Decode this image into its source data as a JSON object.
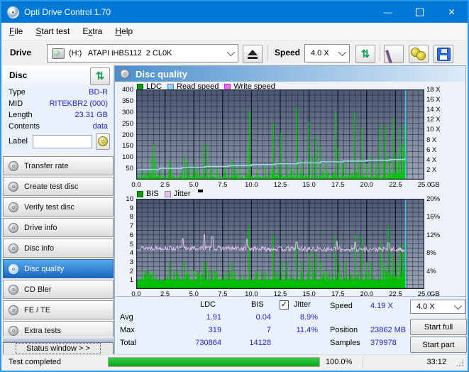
{
  "window": {
    "title": "Opti Drive Control 1.70"
  },
  "menu": {
    "items": [
      {
        "label": "File",
        "u": 0
      },
      {
        "label": "Start test",
        "u": 0
      },
      {
        "label": "Extra",
        "u": 1
      },
      {
        "label": "Help",
        "u": 0
      }
    ]
  },
  "toolbar": {
    "drive_label": "Drive",
    "drive_value": "(H:)   ATAPI iHBS112  2 CL0K",
    "speed_label": "Speed",
    "speed_value": "4.0 X",
    "icons": [
      "drive-icon",
      "eject-icon",
      "refresh-icon",
      "eraser-icon",
      "gold-discs-icon",
      "save-icon"
    ]
  },
  "sidebar": {
    "header": "Disc",
    "info": [
      {
        "label": "Type",
        "value": "BD-R"
      },
      {
        "label": "MID",
        "value": "RITEKBR2 (000)"
      },
      {
        "label": "Length",
        "value": "23.31 GB"
      },
      {
        "label": "Contents",
        "value": "data"
      }
    ],
    "label_field": {
      "label": "Label",
      "value": ""
    },
    "nav": [
      {
        "label": "Transfer rate",
        "active": false
      },
      {
        "label": "Create test disc",
        "active": false
      },
      {
        "label": "Verify test disc",
        "active": false
      },
      {
        "label": "Drive info",
        "active": false
      },
      {
        "label": "Disc info",
        "active": false
      },
      {
        "label": "Disc quality",
        "active": true
      },
      {
        "label": "CD Bler",
        "active": false
      },
      {
        "label": "FE / TE",
        "active": false
      },
      {
        "label": "Extra tests",
        "active": false
      }
    ],
    "status_window_button": "Status window > >"
  },
  "main": {
    "title": "Disc quality"
  },
  "colors": {
    "titlebar": "#0078d7",
    "accent_blue_value": "#2222dd",
    "ldc_green": "#00c800",
    "bis_green": "#00bf00",
    "read_speed_blue": "#9ad8f4",
    "write_speed_magenta": "#f06af0",
    "jitter_pink": "#e2c0ea",
    "end_marker_cyan": "#3cc6f2",
    "progress_green": "#13b31e"
  },
  "chart_data": [
    {
      "type": "bar",
      "name": "ldc-read-speed-chart",
      "legend": [
        {
          "label": "LDC",
          "color": "#0c9a0c"
        },
        {
          "label": "Read speed",
          "color": "#8fd2f2"
        },
        {
          "label": "Write speed",
          "color": "#f06af0"
        }
      ],
      "x_ticks": [
        0.0,
        2.5,
        5.0,
        7.5,
        10.0,
        12.5,
        15.0,
        17.5,
        20.0,
        22.5,
        25.0
      ],
      "x_unit": "GB",
      "x_max": 25.0,
      "y_left_ticks": [
        400,
        350,
        300,
        250,
        200,
        150,
        100,
        50
      ],
      "y_left_max": 400,
      "y_right_ticks": [
        "18 X",
        "16 X",
        "14 X",
        "12 X",
        "10 X",
        "8 X",
        "6 X",
        "4 X",
        "2 X"
      ],
      "y_right_max": 18,
      "data_end_gb": 23.38,
      "ldc_spikes": [
        [
          1.35,
          95
        ],
        [
          1.5,
          152
        ],
        [
          1.65,
          90
        ],
        [
          2.9,
          92
        ],
        [
          3.05,
          60
        ],
        [
          4.2,
          106
        ],
        [
          4.35,
          78
        ],
        [
          4.65,
          55
        ],
        [
          4.95,
          68
        ],
        [
          5.3,
          55
        ],
        [
          5.85,
          150
        ],
        [
          6.15,
          158
        ],
        [
          6.55,
          60
        ],
        [
          7.0,
          58
        ],
        [
          7.75,
          52
        ],
        [
          8.3,
          88
        ],
        [
          8.55,
          60
        ],
        [
          9.0,
          50
        ],
        [
          9.7,
          148
        ],
        [
          9.85,
          305
        ],
        [
          10.5,
          55
        ],
        [
          11.2,
          62
        ],
        [
          11.9,
          250
        ],
        [
          12.3,
          68
        ],
        [
          12.55,
          205
        ],
        [
          13.1,
          82
        ],
        [
          13.5,
          60
        ],
        [
          13.95,
          320
        ],
        [
          14.4,
          92
        ],
        [
          14.95,
          255
        ],
        [
          15.3,
          108
        ],
        [
          15.6,
          190
        ],
        [
          15.95,
          145
        ],
        [
          16.5,
          78
        ],
        [
          17.3,
          305
        ],
        [
          17.55,
          140
        ],
        [
          17.9,
          70
        ],
        [
          18.2,
          88
        ],
        [
          18.95,
          300
        ],
        [
          19.3,
          85
        ],
        [
          19.6,
          230
        ],
        [
          20.0,
          70
        ],
        [
          20.4,
          108
        ],
        [
          20.8,
          78
        ],
        [
          21.15,
          240
        ],
        [
          21.45,
          88
        ],
        [
          21.6,
          238
        ],
        [
          21.95,
          100
        ],
        [
          22.3,
          273
        ],
        [
          22.55,
          118
        ],
        [
          22.85,
          230
        ],
        [
          23.05,
          160
        ],
        [
          23.2,
          130
        ],
        [
          23.3,
          250
        ]
      ],
      "ldc_noise": {
        "seed": 7,
        "step_gb": 0.045,
        "base_min": 3,
        "base_var": 12,
        "spike_prob": 0.2,
        "spike_var": 28,
        "end_dense_from": 22.2
      },
      "read_speed_points": [
        [
          0,
          2.05
        ],
        [
          2,
          2.25
        ],
        [
          4,
          2.45
        ],
        [
          6,
          2.62
        ],
        [
          8,
          2.8
        ],
        [
          10,
          3.0
        ],
        [
          12,
          3.18
        ],
        [
          14,
          3.35
        ],
        [
          16,
          3.55
        ],
        [
          18,
          3.7
        ],
        [
          20,
          3.85
        ],
        [
          22,
          4.0
        ],
        [
          23.3,
          4.15
        ],
        [
          23.38,
          4.19
        ]
      ]
    },
    {
      "type": "bar",
      "name": "bis-jitter-chart",
      "legend": [
        {
          "label": "BIS",
          "color": "#0c9a0c"
        },
        {
          "label": "Jitter",
          "color": "#e2c0ea"
        }
      ],
      "x_ticks": [
        0.0,
        2.5,
        5.0,
        7.5,
        10.0,
        12.5,
        15.0,
        17.5,
        20.0,
        22.5,
        25.0
      ],
      "x_unit": "GB",
      "x_max": 25.0,
      "y_left_ticks": [
        10,
        9,
        8,
        7,
        6,
        5,
        4,
        3,
        2,
        1
      ],
      "y_left_max": 10,
      "y_right_ticks": [
        "20%",
        "16%",
        "12%",
        "8%",
        "4%"
      ],
      "y_right_max": 20,
      "data_end_gb": 23.38,
      "bis_base_level": 1,
      "bis_spikes": [
        [
          0.5,
          2
        ],
        [
          0.8,
          2
        ],
        [
          1.1,
          2
        ],
        [
          1.5,
          2
        ],
        [
          2.9,
          3
        ],
        [
          3.3,
          2
        ],
        [
          4.2,
          3
        ],
        [
          4.5,
          2
        ],
        [
          5.0,
          2
        ],
        [
          5.3,
          2
        ],
        [
          5.9,
          3
        ],
        [
          6.1,
          3
        ],
        [
          6.3,
          2
        ],
        [
          6.6,
          2
        ],
        [
          6.8,
          2
        ],
        [
          7.0,
          2
        ],
        [
          7.8,
          2
        ],
        [
          8.1,
          2
        ],
        [
          8.3,
          3
        ],
        [
          8.5,
          2
        ],
        [
          9.8,
          7
        ],
        [
          10.5,
          2
        ],
        [
          11.2,
          2
        ],
        [
          11.9,
          6
        ],
        [
          12.3,
          2
        ],
        [
          12.6,
          3
        ],
        [
          13.1,
          3
        ],
        [
          13.9,
          5
        ],
        [
          14.4,
          3
        ],
        [
          15.0,
          4
        ],
        [
          15.3,
          3
        ],
        [
          15.6,
          4
        ],
        [
          16.0,
          3
        ],
        [
          16.5,
          2
        ],
        [
          17.3,
          6
        ],
        [
          17.6,
          3
        ],
        [
          18.2,
          3
        ],
        [
          19.0,
          6
        ],
        [
          19.6,
          6
        ],
        [
          20.0,
          3
        ],
        [
          20.4,
          3
        ],
        [
          21.2,
          5
        ],
        [
          21.5,
          3
        ],
        [
          21.9,
          7
        ],
        [
          22.3,
          4
        ],
        [
          22.6,
          3
        ],
        [
          22.9,
          5
        ],
        [
          23.1,
          4
        ],
        [
          23.3,
          5
        ]
      ],
      "bis_noise": {
        "seed": 21,
        "step_gb": 0.07,
        "prob": 0.28,
        "var": 0.9,
        "end_dense_from": 21.5
      },
      "jitter_line": {
        "seed": 13,
        "base": 4.55,
        "noise": 0.5,
        "step_gb": 0.055,
        "peaks": [
          [
            4.05,
            5.6
          ],
          [
            5.9,
            6.0
          ],
          [
            6.6,
            5.8
          ],
          [
            9.6,
            5.5
          ],
          [
            13.9,
            5.2
          ],
          [
            17.4,
            5.3
          ],
          [
            19.0,
            5.2
          ],
          [
            21.9,
            5.1
          ]
        ]
      }
    }
  ],
  "stats": {
    "col_ldc": "LDC",
    "col_bis": "BIS",
    "jitter_label": "Jitter",
    "jitter_checked": "✓",
    "rows": [
      {
        "label": "Avg",
        "ldc": "1.91",
        "bis": "0.04",
        "jitter": "8.9%"
      },
      {
        "label": "Max",
        "ldc": "319",
        "bis": "7",
        "jitter": "11.4%"
      },
      {
        "label": "Total",
        "ldc": "730864",
        "bis": "14128",
        "jitter": ""
      }
    ],
    "speed_label": "Speed",
    "speed_value": "4.19 X",
    "position_label": "Position",
    "position_value": "23862 MB",
    "samples_label": "Samples",
    "samples_value": "379978",
    "speed_select": "4.0 X",
    "start_full": "Start full",
    "start_part": "Start part"
  },
  "statusbar": {
    "status": "Test completed",
    "progress_pct": "100.0%",
    "progress_fraction": 1.0,
    "time": "33:12"
  }
}
